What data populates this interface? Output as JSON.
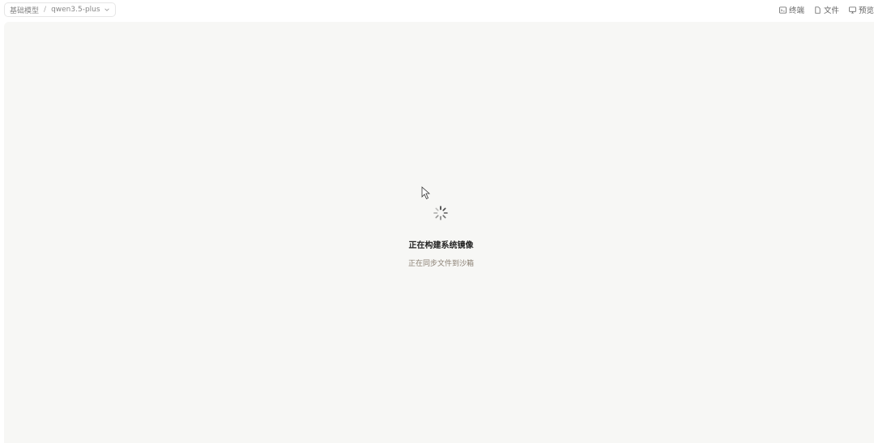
{
  "header": {
    "model_selector": {
      "category": "基础模型",
      "separator": "/",
      "model": "qwen3.5-plus"
    },
    "actions": [
      {
        "label": "终端",
        "icon": "terminal-icon"
      },
      {
        "label": "文件",
        "icon": "file-icon"
      },
      {
        "label": "预览",
        "icon": "monitor-icon"
      }
    ]
  },
  "main": {
    "status_title": "正在构建系统镜像",
    "status_subtitle": "正在同步文件到沙箱"
  },
  "colors": {
    "canvas_bg": "#f7f7f5",
    "subtitle": "#8a7f72"
  }
}
